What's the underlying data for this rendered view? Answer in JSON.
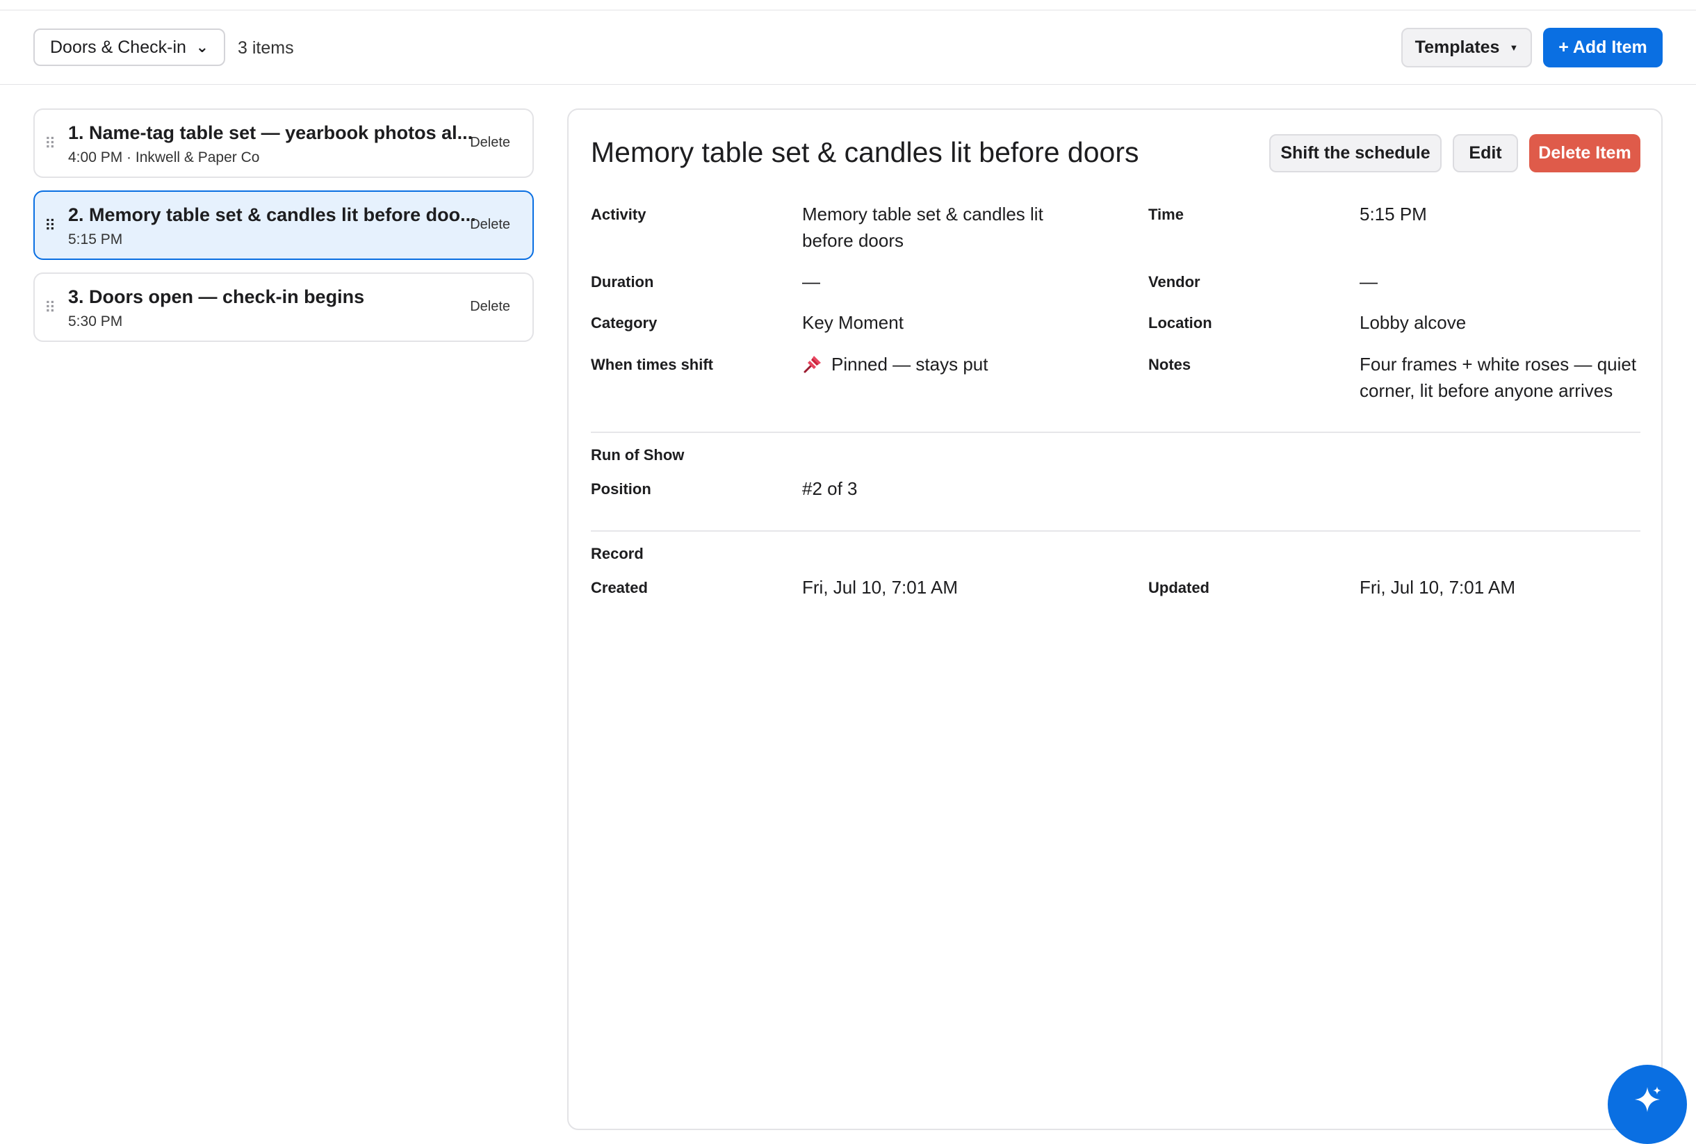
{
  "toolbar": {
    "filter_value": "Doors & Check-in",
    "item_count": "3 items",
    "templates_label": "Templates",
    "add_label": "+ Add Item"
  },
  "items": [
    {
      "title": "1. Name-tag table set — yearbook photos al...",
      "subtitle": "4:00 PM · Inkwell & Paper Co",
      "delete_label": "Delete"
    },
    {
      "title": "2. Memory table set & candles lit before doo...",
      "subtitle": "5:15 PM",
      "delete_label": "Delete"
    },
    {
      "title": "3. Doors open — check-in begins",
      "subtitle": "5:30 PM",
      "delete_label": "Delete"
    }
  ],
  "detail": {
    "title": "Memory table set & candles lit before doors",
    "shift_label": "Shift the schedule",
    "edit_label": "Edit",
    "delete_label": "Delete Item",
    "fields": {
      "activity_label": "Activity",
      "activity_value": "Memory table set & candles lit before doors",
      "time_label": "Time",
      "time_value": "5:15 PM",
      "duration_label": "Duration",
      "duration_value": "—",
      "vendor_label": "Vendor",
      "vendor_value": "—",
      "category_label": "Category",
      "category_value": "Key Moment",
      "location_label": "Location",
      "location_value": "Lobby alcove",
      "shift_behavior_label": "When times shift",
      "shift_behavior_value": "Pinned — stays put",
      "notes_label": "Notes",
      "notes_value": "Four frames + white roses — quiet corner, lit before anyone arrives"
    },
    "run_of_show": {
      "section_label": "Run of Show",
      "position_label": "Position",
      "position_value": "#2 of 3"
    },
    "record": {
      "section_label": "Record",
      "created_label": "Created",
      "created_value": "Fri, Jul 10, 7:01 AM",
      "updated_label": "Updated",
      "updated_value": "Fri, Jul 10, 7:01 AM"
    }
  },
  "icons": {
    "pin": "pushpin-icon",
    "fab": "sparkle-icon",
    "drag": "drag-handle-icon"
  },
  "colors": {
    "accent": "#0a6fe2",
    "danger": "#df5b4a",
    "selected_bg": "#e6f1fd"
  }
}
